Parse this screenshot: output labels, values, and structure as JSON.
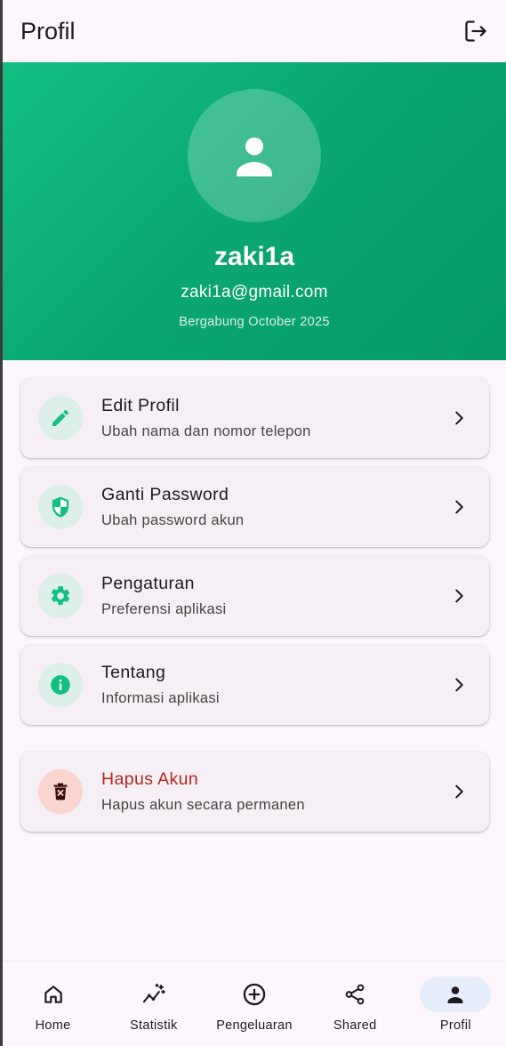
{
  "app_bar": {
    "title": "Profil",
    "logout_icon": "logout-icon"
  },
  "profile": {
    "avatar_icon": "person-icon",
    "username": "zaki1a",
    "email": "zaki1a@gmail.com",
    "joined": "Bergabung October 2025"
  },
  "menu": {
    "items": [
      {
        "title": "Edit Profil",
        "subtitle": "Ubah nama dan nomor telepon",
        "icon": "pencil-icon"
      },
      {
        "title": "Ganti Password",
        "subtitle": "Ubah password akun",
        "icon": "shield-icon"
      },
      {
        "title": "Pengaturan",
        "subtitle": "Preferensi aplikasi",
        "icon": "gear-icon"
      },
      {
        "title": "Tentang",
        "subtitle": "Informasi aplikasi",
        "icon": "info-icon"
      }
    ],
    "danger": {
      "title": "Hapus Akun",
      "subtitle": "Hapus akun secara permanen",
      "icon": "delete-icon"
    }
  },
  "bottom_nav": {
    "items": [
      {
        "label": "Home",
        "icon": "home-icon"
      },
      {
        "label": "Statistik",
        "icon": "stats-icon"
      },
      {
        "label": "Pengeluaran",
        "icon": "add-circle-icon"
      },
      {
        "label": "Shared",
        "icon": "share-icon"
      },
      {
        "label": "Profil",
        "icon": "person-icon",
        "active": true
      }
    ]
  },
  "colors": {
    "accent": "#0aa672",
    "icon_green": "#14bf82",
    "danger": "#b3261e",
    "background": "#fdf7fd"
  }
}
